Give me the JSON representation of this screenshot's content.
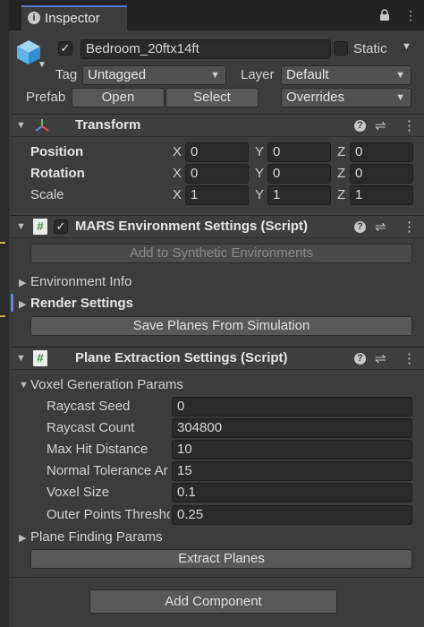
{
  "window": {
    "tab_title": "Inspector"
  },
  "object": {
    "name": "Bedroom_20ftx14ft",
    "active": true,
    "static_label": "Static",
    "tag_label": "Tag",
    "tag_value": "Untagged",
    "layer_label": "Layer",
    "layer_value": "Default",
    "prefab_label": "Prefab",
    "open_label": "Open",
    "select_label": "Select",
    "overrides_label": "Overrides"
  },
  "transform": {
    "title": "Transform",
    "position_label": "Position",
    "rotation_label": "Rotation",
    "scale_label": "Scale",
    "axis_x": "X",
    "axis_y": "Y",
    "axis_z": "Z",
    "position": {
      "x": "0",
      "y": "0",
      "z": "0"
    },
    "rotation": {
      "x": "0",
      "y": "0",
      "z": "0"
    },
    "scale": {
      "x": "1",
      "y": "1",
      "z": "1"
    }
  },
  "mars": {
    "title": "MARS Environment Settings (Script)",
    "enabled": true,
    "add_to_synthetic": "Add to Synthetic Environments",
    "environment_info": "Environment Info",
    "render_settings": "Render Settings",
    "save_planes": "Save Planes From Simulation"
  },
  "plane": {
    "title": "Plane Extraction Settings (Script)",
    "voxel_params": "Voxel Generation Params",
    "fields": [
      {
        "label": "Raycast Seed",
        "value": "0"
      },
      {
        "label": "Raycast Count",
        "value": "304800"
      },
      {
        "label": "Max Hit Distance",
        "value": "10"
      },
      {
        "label": "Normal Tolerance Ar",
        "value": "15"
      },
      {
        "label": "Voxel Size",
        "value": "0.1"
      },
      {
        "label": "Outer Points Thresho",
        "value": "0.25"
      }
    ],
    "plane_finding": "Plane Finding Params",
    "extract_planes": "Extract Planes"
  },
  "add_component": "Add Component",
  "icons": {
    "tab": "info-icon",
    "lock": "lock-icon",
    "menu": "kebab-menu-icon",
    "cube": "cube-icon",
    "transform": "transform-axes-icon",
    "script": "script-icon",
    "help": "help-icon",
    "presets": "presets-icon"
  },
  "colors": {
    "background": "#383838",
    "panel": "#3c3c3c",
    "field": "#2a2a2a",
    "button": "#585858",
    "selection_accent": "#5b8bd8",
    "script_icon_green": "#3b8f3b"
  }
}
